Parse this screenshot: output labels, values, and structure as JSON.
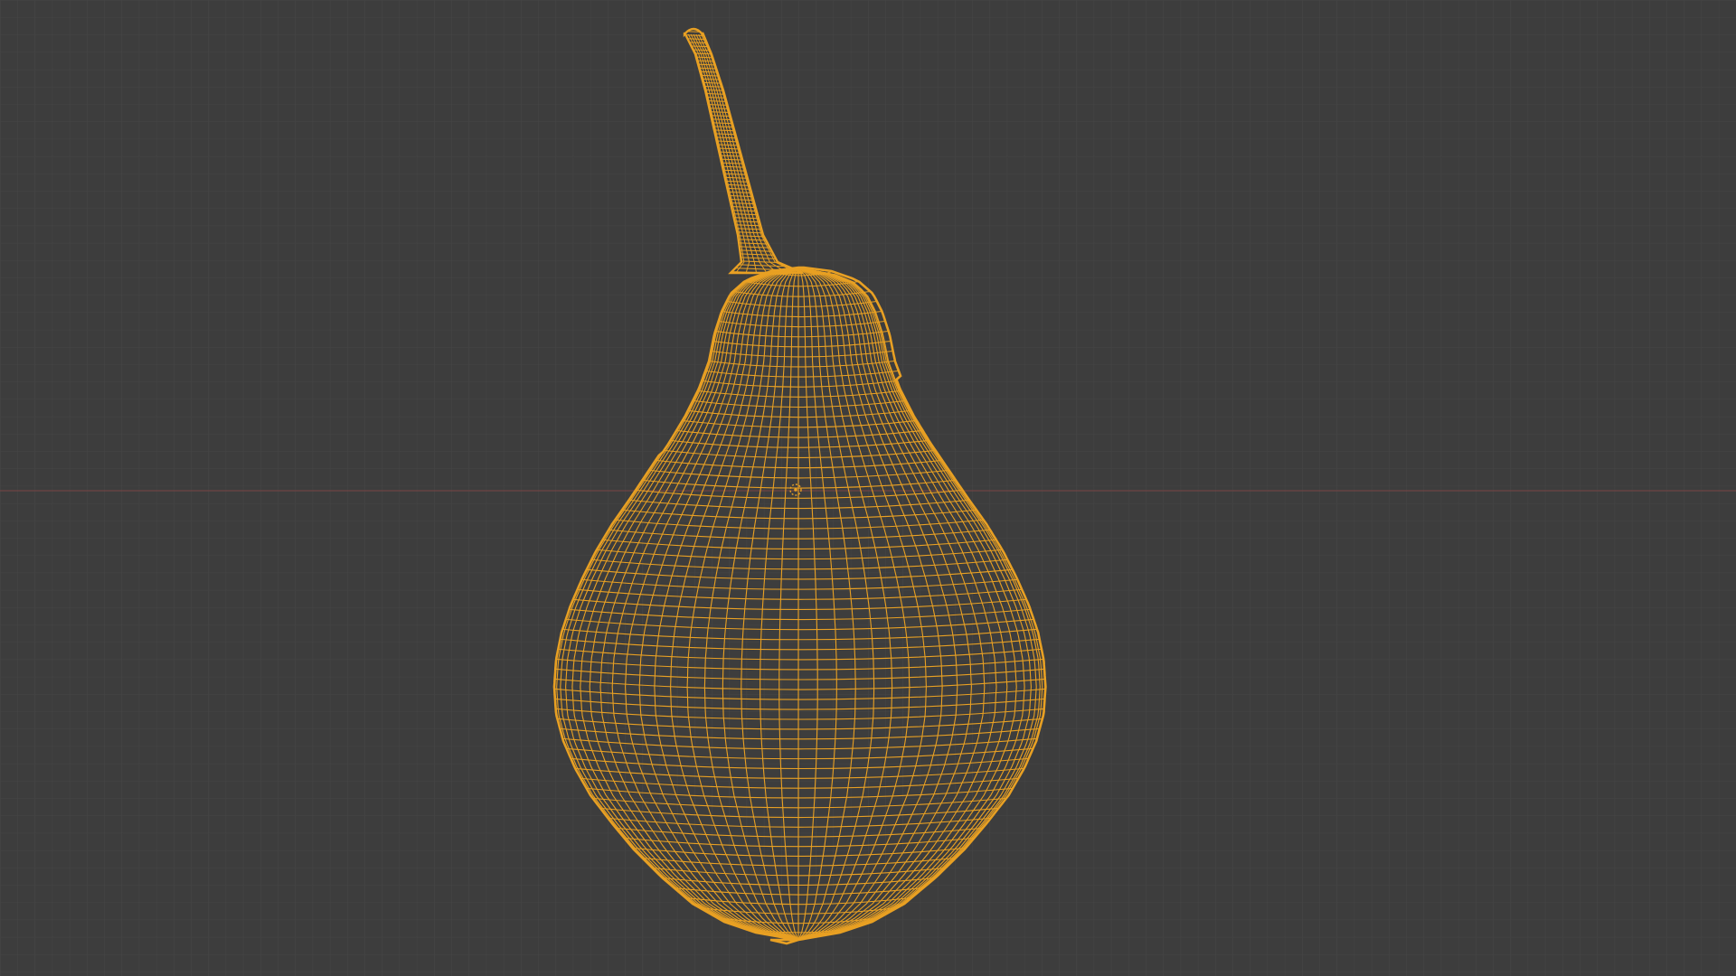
{
  "viewport": {
    "mode": "wireframe",
    "background_color": "#3d3d3d",
    "grid_color": "#484848",
    "x_axis_color": "#7a4a4a",
    "object": {
      "name_icon": "pear-mesh",
      "wire_color": "#e8a023",
      "highlight_color": "#ffb42e",
      "selected": true
    },
    "origin_marker_icon": "object-origin-icon"
  }
}
